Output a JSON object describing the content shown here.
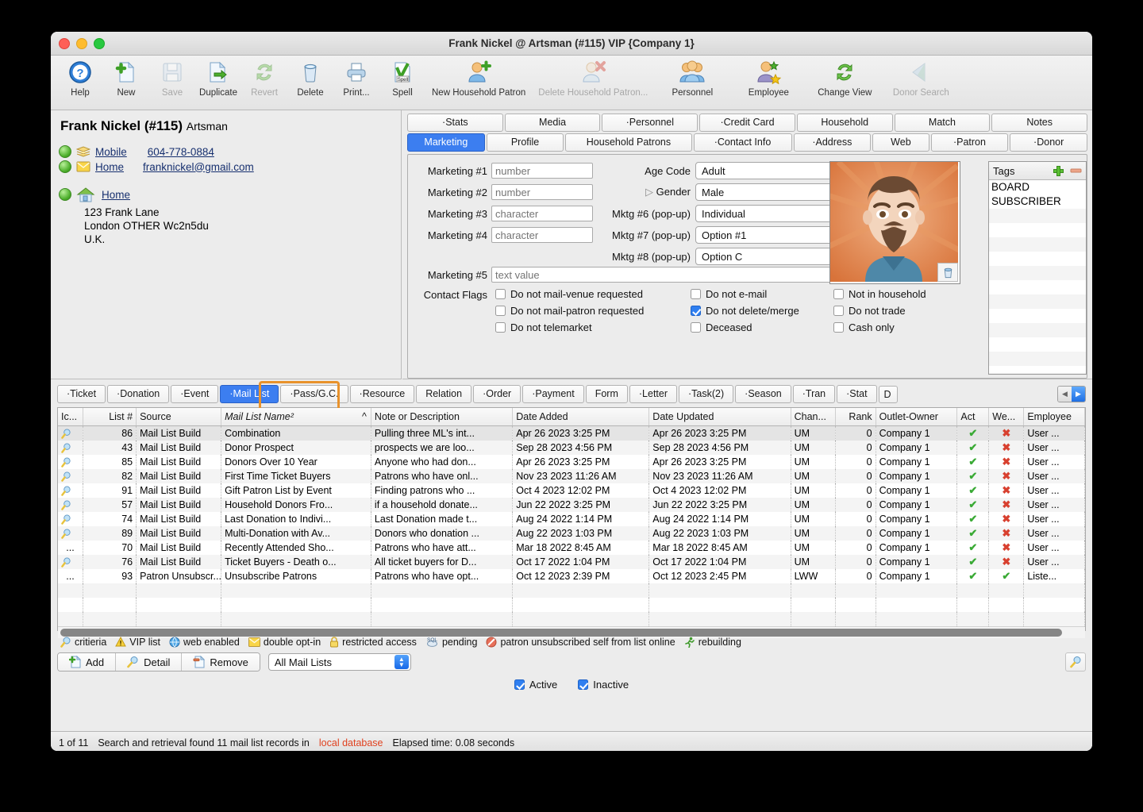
{
  "window": {
    "title": "Frank Nickel @ Artsman (#115) VIP {Company 1}"
  },
  "toolbar": [
    {
      "label": "Help",
      "icon": "help-icon",
      "disabled": false
    },
    {
      "label": "New",
      "icon": "new-document-icon",
      "disabled": false
    },
    {
      "label": "Save",
      "icon": "save-floppy-icon",
      "disabled": true
    },
    {
      "label": "Duplicate",
      "icon": "duplicate-icon",
      "disabled": false
    },
    {
      "label": "Revert",
      "icon": "revert-refresh-icon",
      "disabled": true
    },
    {
      "label": "Delete",
      "icon": "trash-icon",
      "disabled": false
    },
    {
      "label": "Print...",
      "icon": "printer-icon",
      "disabled": false
    },
    {
      "label": "Spell",
      "icon": "spell-check-icon",
      "disabled": false
    },
    {
      "label": "New Household Patron",
      "icon": "add-person-icon",
      "disabled": false
    },
    {
      "label": "Delete Household Patron...",
      "icon": "delete-person-icon",
      "disabled": true
    },
    {
      "label": "Personnel",
      "icon": "people-group-icon",
      "disabled": false
    },
    {
      "label": "Employee",
      "icon": "employee-star-icon",
      "disabled": false
    },
    {
      "label": "Change View",
      "icon": "change-view-refresh-icon",
      "disabled": false
    },
    {
      "label": "Donor Search",
      "icon": "donor-search-icon",
      "disabled": true
    }
  ],
  "patron": {
    "name": "Frank Nickel (#115)",
    "org": "Artsman",
    "contacts": [
      {
        "type": "Mobile",
        "value": "604-778-0884",
        "icon": "phone-card-icon"
      },
      {
        "type": "Home",
        "value": "franknickel@gmail.com",
        "icon": "envelope-icon"
      }
    ],
    "address_label": "Home",
    "address_lines": [
      "123 Frank Lane",
      "London OTHER  Wc2n5du",
      "U.K."
    ]
  },
  "detail_tabs_row1": [
    {
      "label": "·Stats",
      "selected": false
    },
    {
      "label": "Media",
      "selected": false
    },
    {
      "label": "·Personnel",
      "selected": false
    },
    {
      "label": "·Credit Card",
      "selected": false
    },
    {
      "label": "Household",
      "selected": false
    },
    {
      "label": "Match",
      "selected": false
    },
    {
      "label": "Notes",
      "selected": false
    }
  ],
  "detail_tabs_row2": [
    {
      "label": "Marketing",
      "selected": true
    },
    {
      "label": "Profile",
      "selected": false
    },
    {
      "label": "Household Patrons",
      "selected": false
    },
    {
      "label": "·Contact Info",
      "selected": false
    },
    {
      "label": "·Address",
      "selected": false
    },
    {
      "label": "Web",
      "selected": false
    },
    {
      "label": "·Patron",
      "selected": false
    },
    {
      "label": "·Donor",
      "selected": false
    }
  ],
  "marketing": {
    "fields": [
      {
        "label": "Marketing #1",
        "placeholder": "number",
        "value": ""
      },
      {
        "label": "Marketing #2",
        "placeholder": "number",
        "value": ""
      },
      {
        "label": "Marketing #3",
        "placeholder": "character",
        "value": ""
      },
      {
        "label": "Marketing #4",
        "placeholder": "character",
        "value": ""
      }
    ],
    "marketing5_label": "Marketing #5",
    "marketing5_placeholder": "text value",
    "popups": [
      {
        "label": "Age Code",
        "value": "Adult"
      },
      {
        "label": "Gender",
        "value": "Male"
      },
      {
        "label": "Mktg #6 (pop-up)",
        "value": "Individual"
      },
      {
        "label": "Mktg #7 (pop-up)",
        "value": "Option #1"
      },
      {
        "label": "Mktg #8 (pop-up)",
        "value": "Option C"
      }
    ],
    "contact_flags_label": "Contact Flags",
    "flags_col1": [
      {
        "label": "Do not mail-venue requested",
        "checked": false
      },
      {
        "label": "Do not mail-patron requested",
        "checked": false
      },
      {
        "label": "Do not telemarket",
        "checked": false
      }
    ],
    "flags_col2": [
      {
        "label": "Do not e-mail",
        "checked": false
      },
      {
        "label": "Do not delete/merge",
        "checked": true
      },
      {
        "label": "Deceased",
        "checked": false
      }
    ],
    "flags_col3": [
      {
        "label": "Not in household",
        "checked": false
      },
      {
        "label": "Do not trade",
        "checked": false
      },
      {
        "label": "Cash only",
        "checked": false
      }
    ]
  },
  "tags": {
    "title": "Tags",
    "add_icon": "plus-icon",
    "remove_icon": "minus-icon",
    "items": [
      "BOARD",
      "SUBSCRIBER"
    ]
  },
  "bottom_tabs": [
    {
      "label": "·Ticket",
      "selected": false
    },
    {
      "label": "·Donation",
      "selected": false
    },
    {
      "label": "·Event",
      "selected": false
    },
    {
      "label": "·Mail List",
      "selected": true
    },
    {
      "label": "·Pass/G.C.",
      "selected": false
    },
    {
      "label": "·Resource",
      "selected": false
    },
    {
      "label": "Relation",
      "selected": false
    },
    {
      "label": "·Order",
      "selected": false
    },
    {
      "label": "·Payment",
      "selected": false
    },
    {
      "label": "Form",
      "selected": false
    },
    {
      "label": "·Letter",
      "selected": false
    },
    {
      "label": "·Task(2)",
      "selected": false
    },
    {
      "label": "·Season",
      "selected": false
    },
    {
      "label": "·Tran",
      "selected": false
    },
    {
      "label": "·Stat",
      "selected": false
    },
    {
      "label": "D",
      "selected": false
    }
  ],
  "table": {
    "columns": [
      "Ic...",
      "List #",
      "Source",
      "Mail List Name²",
      "Note or Description",
      "Date Added",
      "Date Updated",
      "Chan...",
      "Rank",
      "Outlet-Owner",
      "Act",
      "We...",
      "Employee"
    ],
    "sort_column": "Mail List Name²",
    "sort_indicator": "^",
    "rows": [
      {
        "icon": "criteria-icon",
        "list": "86",
        "source": "Mail List Build",
        "name": "Combination",
        "note": "Pulling three ML's int...",
        "added": "Apr 26 2023 3:25 PM",
        "updated": "Apr 26 2023 3:25 PM",
        "chan": "UM",
        "rank": "0",
        "outlet": "Company 1",
        "act": "check",
        "web": "x",
        "employee": "User ..."
      },
      {
        "icon": "criteria-icon",
        "list": "43",
        "source": "Mail List Build",
        "name": "Donor Prospect",
        "note": "prospects we are loo...",
        "added": "Sep 28 2023 4:56 PM",
        "updated": "Sep 28 2023 4:56 PM",
        "chan": "UM",
        "rank": "0",
        "outlet": "Company 1",
        "act": "check",
        "web": "x",
        "employee": "User ..."
      },
      {
        "icon": "criteria-icon",
        "list": "85",
        "source": "Mail List Build",
        "name": "Donors Over 10 Year",
        "note": "Anyone who had don...",
        "added": "Apr 26 2023 3:25 PM",
        "updated": "Apr 26 2023 3:25 PM",
        "chan": "UM",
        "rank": "0",
        "outlet": "Company 1",
        "act": "check",
        "web": "x",
        "employee": "User ..."
      },
      {
        "icon": "criteria-icon",
        "list": "82",
        "source": "Mail List Build",
        "name": "First Time Ticket Buyers",
        "note": "Patrons who have onl...",
        "added": "Nov 23 2023 11:26 AM",
        "updated": "Nov 23 2023 11:26 AM",
        "chan": "UM",
        "rank": "0",
        "outlet": "Company 1",
        "act": "check",
        "web": "x",
        "employee": "User ..."
      },
      {
        "icon": "criteria-icon",
        "list": "91",
        "source": "Mail List Build",
        "name": "Gift Patron List by Event",
        "note": "Finding patrons who ...",
        "added": "Oct 4 2023 12:02 PM",
        "updated": "Oct 4 2023 12:02 PM",
        "chan": "UM",
        "rank": "0",
        "outlet": "Company 1",
        "act": "check",
        "web": "x",
        "employee": "User ..."
      },
      {
        "icon": "criteria-icon",
        "list": "57",
        "source": "Mail List Build",
        "name": "Household Donors Fro...",
        "note": "if a household donate...",
        "added": "Jun 22 2022 3:25 PM",
        "updated": "Jun 22 2022 3:25 PM",
        "chan": "UM",
        "rank": "0",
        "outlet": "Company 1",
        "act": "check",
        "web": "x",
        "employee": "User ..."
      },
      {
        "icon": "criteria-icon",
        "list": "74",
        "source": "Mail List Build",
        "name": "Last Donation to Indivi...",
        "note": "Last Donation made t...",
        "added": "Aug 24 2022 1:14 PM",
        "updated": "Aug 24 2022 1:14 PM",
        "chan": "UM",
        "rank": "0",
        "outlet": "Company 1",
        "act": "check",
        "web": "x",
        "employee": "User ..."
      },
      {
        "icon": "criteria-icon",
        "list": "89",
        "source": "Mail List Build",
        "name": "Multi-Donation with Av...",
        "note": "Donors who donation ...",
        "added": "Aug 22 2023 1:03 PM",
        "updated": "Aug 22 2023 1:03 PM",
        "chan": "UM",
        "rank": "0",
        "outlet": "Company 1",
        "act": "check",
        "web": "x",
        "employee": "User ..."
      },
      {
        "icon": "ellipsis",
        "list": "70",
        "source": "Mail List Build",
        "name": "Recently Attended Sho...",
        "note": "Patrons who have att...",
        "added": "Mar 18 2022 8:45 AM",
        "updated": "Mar 18 2022 8:45 AM",
        "chan": "UM",
        "rank": "0",
        "outlet": "Company 1",
        "act": "check",
        "web": "x",
        "employee": "User ..."
      },
      {
        "icon": "criteria-icon",
        "list": "76",
        "source": "Mail List Build",
        "name": "Ticket Buyers - Death o...",
        "note": "All ticket buyers for D...",
        "added": "Oct 17 2022 1:04 PM",
        "updated": "Oct 17 2022 1:04 PM",
        "chan": "UM",
        "rank": "0",
        "outlet": "Company 1",
        "act": "check",
        "web": "x",
        "employee": "User ..."
      },
      {
        "icon": "ellipsis",
        "list": "93",
        "source": "Patron Unsubscr...",
        "name": "Unsubscribe Patrons",
        "note": "Patrons who have opt...",
        "added": "Oct 12 2023 2:39 PM",
        "updated": "Oct 12 2023 2:45 PM",
        "chan": "LWW",
        "rank": "0",
        "outlet": "Company 1",
        "act": "check",
        "web": "check",
        "employee": "Liste..."
      }
    ]
  },
  "legend": [
    {
      "icon": "criteria-icon",
      "label": "critieria"
    },
    {
      "icon": "warning-icon",
      "label": "VIP list"
    },
    {
      "icon": "globe-icon",
      "label": "web enabled"
    },
    {
      "icon": "envelope-icon",
      "label": "double opt-in"
    },
    {
      "icon": "lock-icon",
      "label": "restricted access"
    },
    {
      "icon": "sql-icon",
      "label": "pending"
    },
    {
      "icon": "no-entry-icon",
      "label": "patron unsubscribed self from list online"
    },
    {
      "icon": "runner-icon",
      "label": "rebuilding"
    }
  ],
  "actions": {
    "add_label": "Add",
    "detail_label": "Detail",
    "remove_label": "Remove",
    "filter_value": "All Mail Lists",
    "search_icon": "magnifier-icon",
    "active_label": "Active",
    "active_checked": true,
    "inactive_label": "Inactive",
    "inactive_checked": true
  },
  "status": {
    "position": "1 of 11",
    "message_prefix": "Search and retrieval found 11 mail list records in",
    "source": "local database",
    "elapsed": "Elapsed time: 0.08 seconds"
  },
  "colors": {
    "accent_blue": "#3c7ef0",
    "highlight_orange": "#e8922c",
    "check_green": "#3aaa35",
    "x_red": "#d8402f",
    "status_red": "#e0411f"
  }
}
